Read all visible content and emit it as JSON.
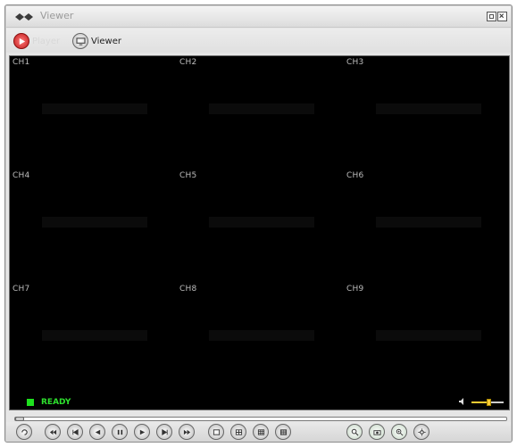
{
  "window": {
    "title": "Viewer"
  },
  "modes": [
    {
      "label": "Player",
      "icon": "player-icon"
    },
    {
      "label": "Viewer",
      "icon": "viewer-icon"
    }
  ],
  "channels": [
    "CH1",
    "CH2",
    "CH3",
    "CH4",
    "CH5",
    "CH6",
    "CH7",
    "CH8",
    "CH9"
  ],
  "status": {
    "text": "READY",
    "color": "#2ee02e"
  },
  "volume": {
    "level": 0.55
  },
  "seek": {
    "position": 0.0
  },
  "controls": {
    "playback": [
      "rewind-icon",
      "step-back-icon",
      "reverse-play-icon",
      "pause-icon",
      "play-icon",
      "step-forward-icon",
      "fast-forward-icon"
    ],
    "layout": [
      "single-view-icon",
      "quad-view-icon",
      "nine-view-icon",
      "sixteen-view-icon"
    ],
    "tools": [
      "search-icon",
      "capture-icon",
      "zoom-icon",
      "settings-icon"
    ]
  },
  "colors": {
    "video_bg": "#000000",
    "player_accent": "#c11b1b",
    "channel_label": "#bdbdbd"
  }
}
